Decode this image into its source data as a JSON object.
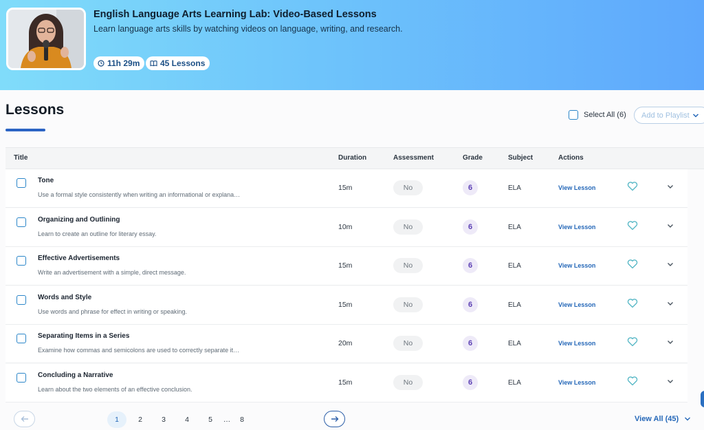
{
  "hero": {
    "title": "English Language Arts Learning Lab: Video-Based Lessons",
    "subtitle": "Learn language arts skills by watching videos on language, writing, and research.",
    "duration": "11h 29m",
    "lessons_count": "45 Lessons"
  },
  "lessons": {
    "title": "Lessons",
    "select_all": "Select All (6)",
    "add_to_playlist": "Add to Playlist"
  },
  "table": {
    "headers": {
      "title": "Title",
      "duration": "Duration",
      "assessment": "Assessment",
      "grade": "Grade",
      "subject": "Subject",
      "actions": "Actions"
    },
    "rows": [
      {
        "title": "Tone",
        "description": "Use a formal style consistently when writing an informational or explana…",
        "duration": "15m",
        "assessment": "No",
        "grade": "6",
        "subject": "ELA",
        "action": "View Lesson"
      },
      {
        "title": "Organizing and Outlining",
        "description": "Learn to create an outline for literary essay.",
        "duration": "10m",
        "assessment": "No",
        "grade": "6",
        "subject": "ELA",
        "action": "View Lesson"
      },
      {
        "title": "Effective Advertisements",
        "description": "Write an advertisement with a simple, direct message.",
        "duration": "15m",
        "assessment": "No",
        "grade": "6",
        "subject": "ELA",
        "action": "View Lesson"
      },
      {
        "title": "Words and Style",
        "description": "Use words and phrase for effect in writing or speaking.",
        "duration": "15m",
        "assessment": "No",
        "grade": "6",
        "subject": "ELA",
        "action": "View Lesson"
      },
      {
        "title": "Separating Items in a Series",
        "description": "Examine how commas and semicolons are used to correctly separate it…",
        "duration": "20m",
        "assessment": "No",
        "grade": "6",
        "subject": "ELA",
        "action": "View Lesson"
      },
      {
        "title": "Concluding a Narrative",
        "description": "Learn about the two elements of an effective conclusion.",
        "duration": "15m",
        "assessment": "No",
        "grade": "6",
        "subject": "ELA",
        "action": "View Lesson"
      }
    ]
  },
  "pagination": {
    "pages": [
      "1",
      "2",
      "3",
      "4",
      "5",
      "…",
      "8"
    ],
    "current_page": "1",
    "view_all": "View All (45)"
  },
  "icons": {
    "duration": "clock-icon",
    "lessons": "book-icon",
    "prev": "arrow-left-icon",
    "next": "arrow-right-icon",
    "favorite": "heart-icon",
    "expand": "chevron-down-icon"
  },
  "colors": {
    "accent": "#2467b8",
    "hero_start": "#80dcfa",
    "hero_end": "#5ea8fc",
    "checkbox": "#2b86c9",
    "heart": "#58b8c6",
    "grade_text": "#5b3fb3"
  }
}
